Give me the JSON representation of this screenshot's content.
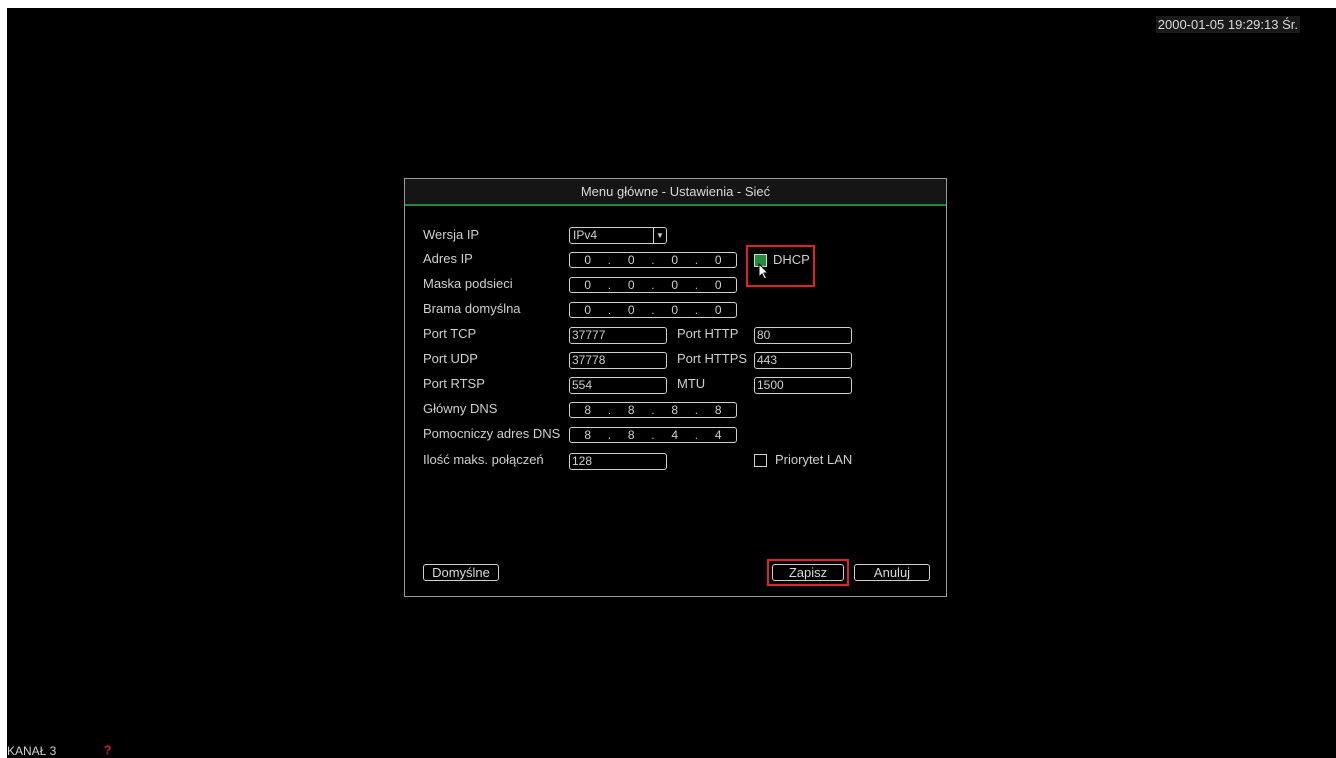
{
  "status_bar": {
    "datetime": "2000-01-05 19:29:13 Śr.",
    "channel": "KANAŁ 3",
    "alert_glyph": "?"
  },
  "dialog": {
    "title": "Menu główne - Ustawienia - Sieć",
    "fields": {
      "ip_version_label": "Wersja IP",
      "ip_version_value": "IPv4",
      "ip_address_label": "Adres IP",
      "ip_address": [
        "0",
        "0",
        "0",
        "0"
      ],
      "dhcp_label": "DHCP",
      "subnet_mask_label": "Maska podsieci",
      "subnet_mask": [
        "0",
        "0",
        "0",
        "0"
      ],
      "gateway_label": "Brama domyślna",
      "gateway": [
        "0",
        "0",
        "0",
        "0"
      ],
      "tcp_port_label": "Port TCP",
      "tcp_port": "37777",
      "http_port_label": "Port HTTP",
      "http_port": "80",
      "udp_port_label": "Port UDP",
      "udp_port": "37778",
      "https_port_label": "Port HTTPS",
      "https_port": "443",
      "rtsp_port_label": "Port RTSP",
      "rtsp_port": "554",
      "mtu_label": "MTU",
      "mtu": "1500",
      "primary_dns_label": "Główny DNS",
      "primary_dns": [
        "8",
        "8",
        "8",
        "8"
      ],
      "secondary_dns_label": "Pomocniczy adres DNS",
      "secondary_dns": [
        "8",
        "8",
        "4",
        "4"
      ],
      "max_connections_label": "Ilość maks. połączeń",
      "max_connections": "128",
      "lan_priority_label": "Priorytet LAN"
    },
    "buttons": {
      "default": "Domyślne",
      "save": "Zapisz",
      "cancel": "Anuluj"
    }
  },
  "colors": {
    "accent": "#1f8a3a",
    "highlight": "#e0202a",
    "checked": "#2a8a3e"
  }
}
